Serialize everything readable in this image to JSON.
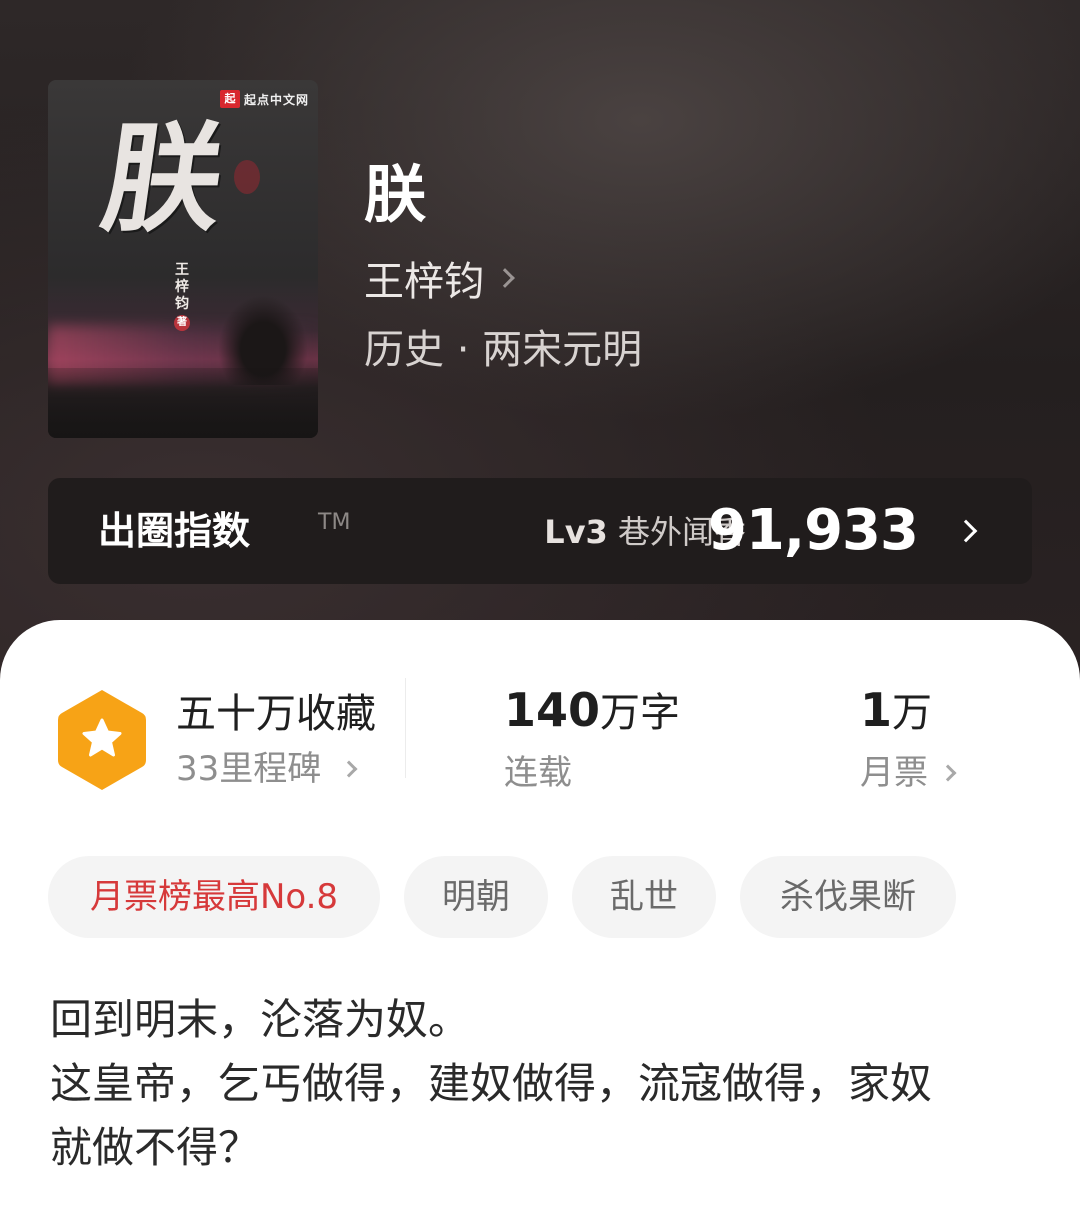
{
  "cover": {
    "publisher_mark": "起",
    "publisher_name": "起点中文网",
    "title_char": "朕",
    "author_vertical": "王梓钧",
    "author_suffix": "著"
  },
  "book": {
    "title": "朕",
    "author": "王梓钧",
    "genre": "历史 · 两宋元明"
  },
  "influence": {
    "label": "出圈指数",
    "tm": "TM",
    "level_code": "Lv3",
    "level_name": "巷外闻香",
    "score": "91,933"
  },
  "stats": {
    "collection_title": "五十万收藏",
    "collection_sub": "33里程碑",
    "words_number": "140",
    "words_unit": "万字",
    "words_sub": "连载",
    "tickets_number": "1",
    "tickets_unit": "万",
    "tickets_sub": "月票"
  },
  "tags": [
    "月票榜最高No.8",
    "明朝",
    "乱世",
    "杀伐果断"
  ],
  "description": {
    "line1": "回到明末，沦落为奴。",
    "line2": "这皇帝，乞丐做得，建奴做得，流寇做得，家奴",
    "line3": "就做不得？"
  },
  "colors": {
    "hero_bg": "#2a2424",
    "badge": "#f7a316",
    "hot_tag_text": "#d6393a",
    "tag_bg": "#f4f4f4"
  }
}
